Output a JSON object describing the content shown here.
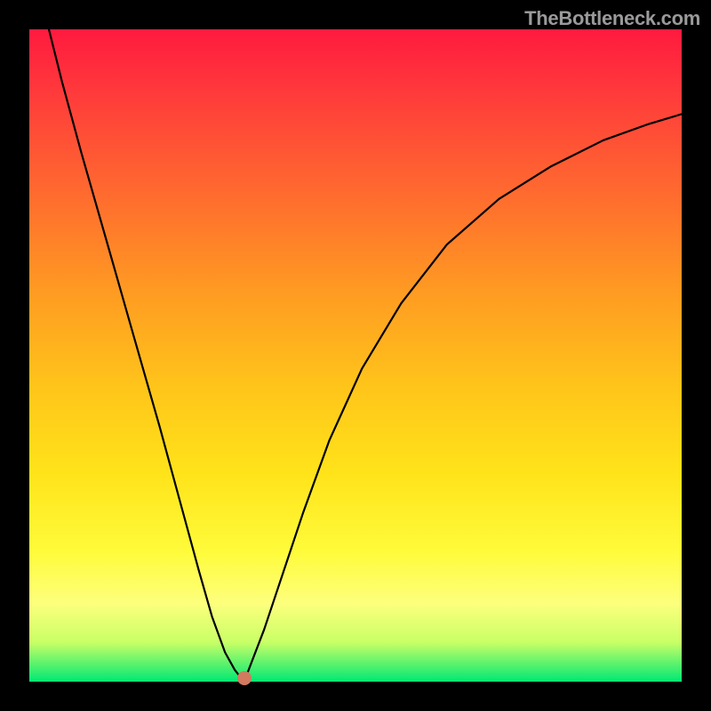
{
  "watermark": "TheBottleneck.com",
  "chart_data": {
    "type": "line",
    "title": "",
    "xlabel": "",
    "ylabel": "",
    "xlim": [
      0,
      100
    ],
    "ylim": [
      0,
      100
    ],
    "series": [
      {
        "name": "curve",
        "x": [
          3,
          5,
          8,
          12,
          16,
          20,
          23,
          26,
          28,
          30,
          31.5,
          32.5,
          33.5,
          36,
          39,
          42,
          46,
          51,
          57,
          64,
          72,
          80,
          88,
          95,
          100
        ],
        "y": [
          100,
          92,
          81,
          67,
          53,
          39,
          28,
          17,
          10,
          4.5,
          1.8,
          0.5,
          1.5,
          8,
          17,
          26,
          37,
          48,
          58,
          67,
          74,
          79,
          83,
          85.5,
          87
        ]
      }
    ],
    "marker": {
      "x": 33,
      "y": 0.5,
      "color": "#d17a5f"
    },
    "gradient_colors": [
      "#ff1a3f",
      "#ffc51a",
      "#fdff7d",
      "#00e874"
    ]
  }
}
